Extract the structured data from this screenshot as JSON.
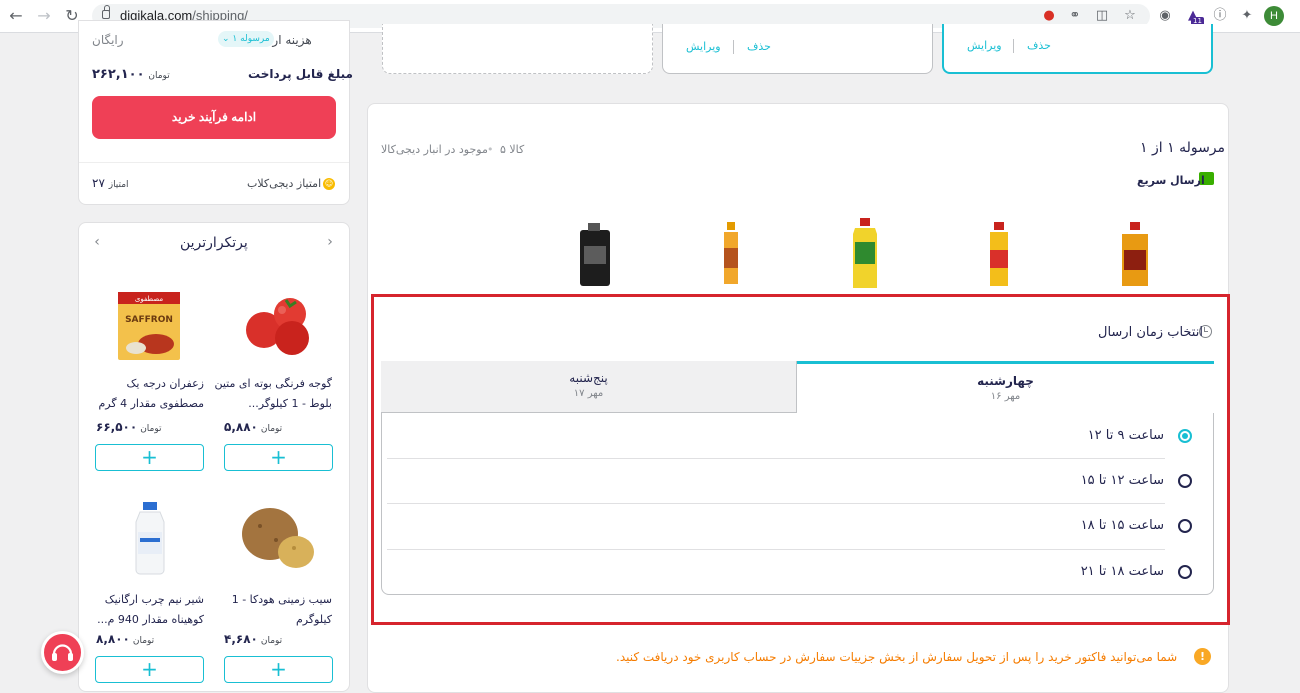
{
  "browser": {
    "url_host": "digikala.com",
    "url_path": "/shipping/",
    "profile_initial": "H",
    "extension_badge": "11"
  },
  "summary": {
    "shipping_cost_label": "هزینه ارسال",
    "shipping_badge": "۱ مرسوله",
    "shipping_cost_value": "رایگان",
    "payable_label": "مبلغ قابل پرداخت",
    "payable_value": "۲۶۲,۱۰۰",
    "currency": "تومان",
    "continue_button": "ادامه فرآیند خرید",
    "club_label": "امتیاز دیجی‌کلاب",
    "club_points": "۲۷",
    "club_unit": "امتیاز"
  },
  "recommend": {
    "title": "پرتکرارترین",
    "products": [
      {
        "name": "گوجه فرنگی بوته ای متین بلوط - 1 کیلوگر...",
        "price": "۵,۸۸۰",
        "currency": "تومان"
      },
      {
        "name": "زعفران درجه یک مصطفوی مقدار 4 گرم",
        "price": "۶۶,۵۰۰",
        "currency": "تومان"
      },
      {
        "name": "سیب زمینی هودکا - 1 کیلوگرم",
        "price": "۴,۶۸۰",
        "currency": "تومان"
      },
      {
        "name": "شیر نیم چرب ارگانیک کوهیناه مقدار 940 م...",
        "price": "۸,۸۰۰",
        "currency": "تومان"
      }
    ],
    "saffron_pack_text": "SAFFRON",
    "saffron_brand_text": "مصطفوی"
  },
  "address": {
    "edit": "ویرایش",
    "delete": "حذف"
  },
  "shipment": {
    "title": "مرسوله ۱ از ۱",
    "count": "۵ کالا",
    "stock": "موجود در انبار دیجی‌کالا",
    "fast_label": "ارسال سریع",
    "time_title": "انتخاب زمان ارسال",
    "tabs": [
      {
        "day": "چهارشنبه",
        "date": "۱۶ مهر"
      },
      {
        "day": "پنج‌شنبه",
        "date": "۱۷ مهر"
      }
    ],
    "slots": [
      {
        "label": "ساعت ۹ تا ۱۲"
      },
      {
        "label": "ساعت ۱۲ تا ۱۵"
      },
      {
        "label": "ساعت ۱۵ تا ۱۸"
      },
      {
        "label": "ساعت ۱۸ تا ۲۱"
      }
    ],
    "selected_slot": 0,
    "invoice_note": "شما می‌توانید فاکتور خرید را پس از تحویل سفارش از بخش جزییات سفارش در حساب کاربری خود دریافت کنید."
  },
  "colors": {
    "brand_red": "#ef4056",
    "accent_cyan": "#19bfd3",
    "highlight_red": "#d6242d"
  }
}
